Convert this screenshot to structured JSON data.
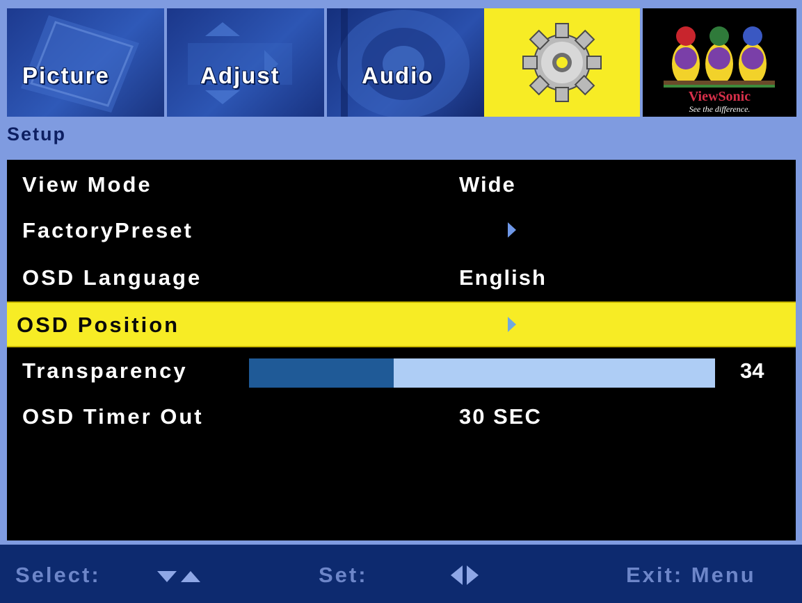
{
  "tabs": [
    {
      "label": "Picture"
    },
    {
      "label": "Adjust"
    },
    {
      "label": "Audio"
    },
    {
      "icon": "gear-icon"
    },
    {
      "icon": "viewsonic-logo",
      "brand": "ViewSonic",
      "tagline": "See the difference."
    }
  ],
  "section_title": "Setup",
  "menu": [
    {
      "label": "View Mode",
      "value": "Wide"
    },
    {
      "label": "FactoryPreset",
      "value_icon": "right-arrow-icon"
    },
    {
      "label": "OSD Language",
      "value": "English"
    },
    {
      "label": "OSD Position",
      "value_icon": "right-arrow-icon",
      "selected": true
    },
    {
      "label": "Transparency",
      "value": "34",
      "level_percent": 31
    },
    {
      "label": "OSD Timer Out",
      "value": "30 SEC"
    }
  ],
  "footer": {
    "select_label": "Select:",
    "select_icon": "up-down-arrows-icon",
    "set_label": "Set:",
    "set_icon": "left-right-arrows-icon",
    "exit_label": "Exit: Menu"
  },
  "colors": {
    "highlight": "#f7ec25",
    "background": "#7f9be0",
    "panel": "#000000",
    "footer": "#0d2a6f"
  }
}
